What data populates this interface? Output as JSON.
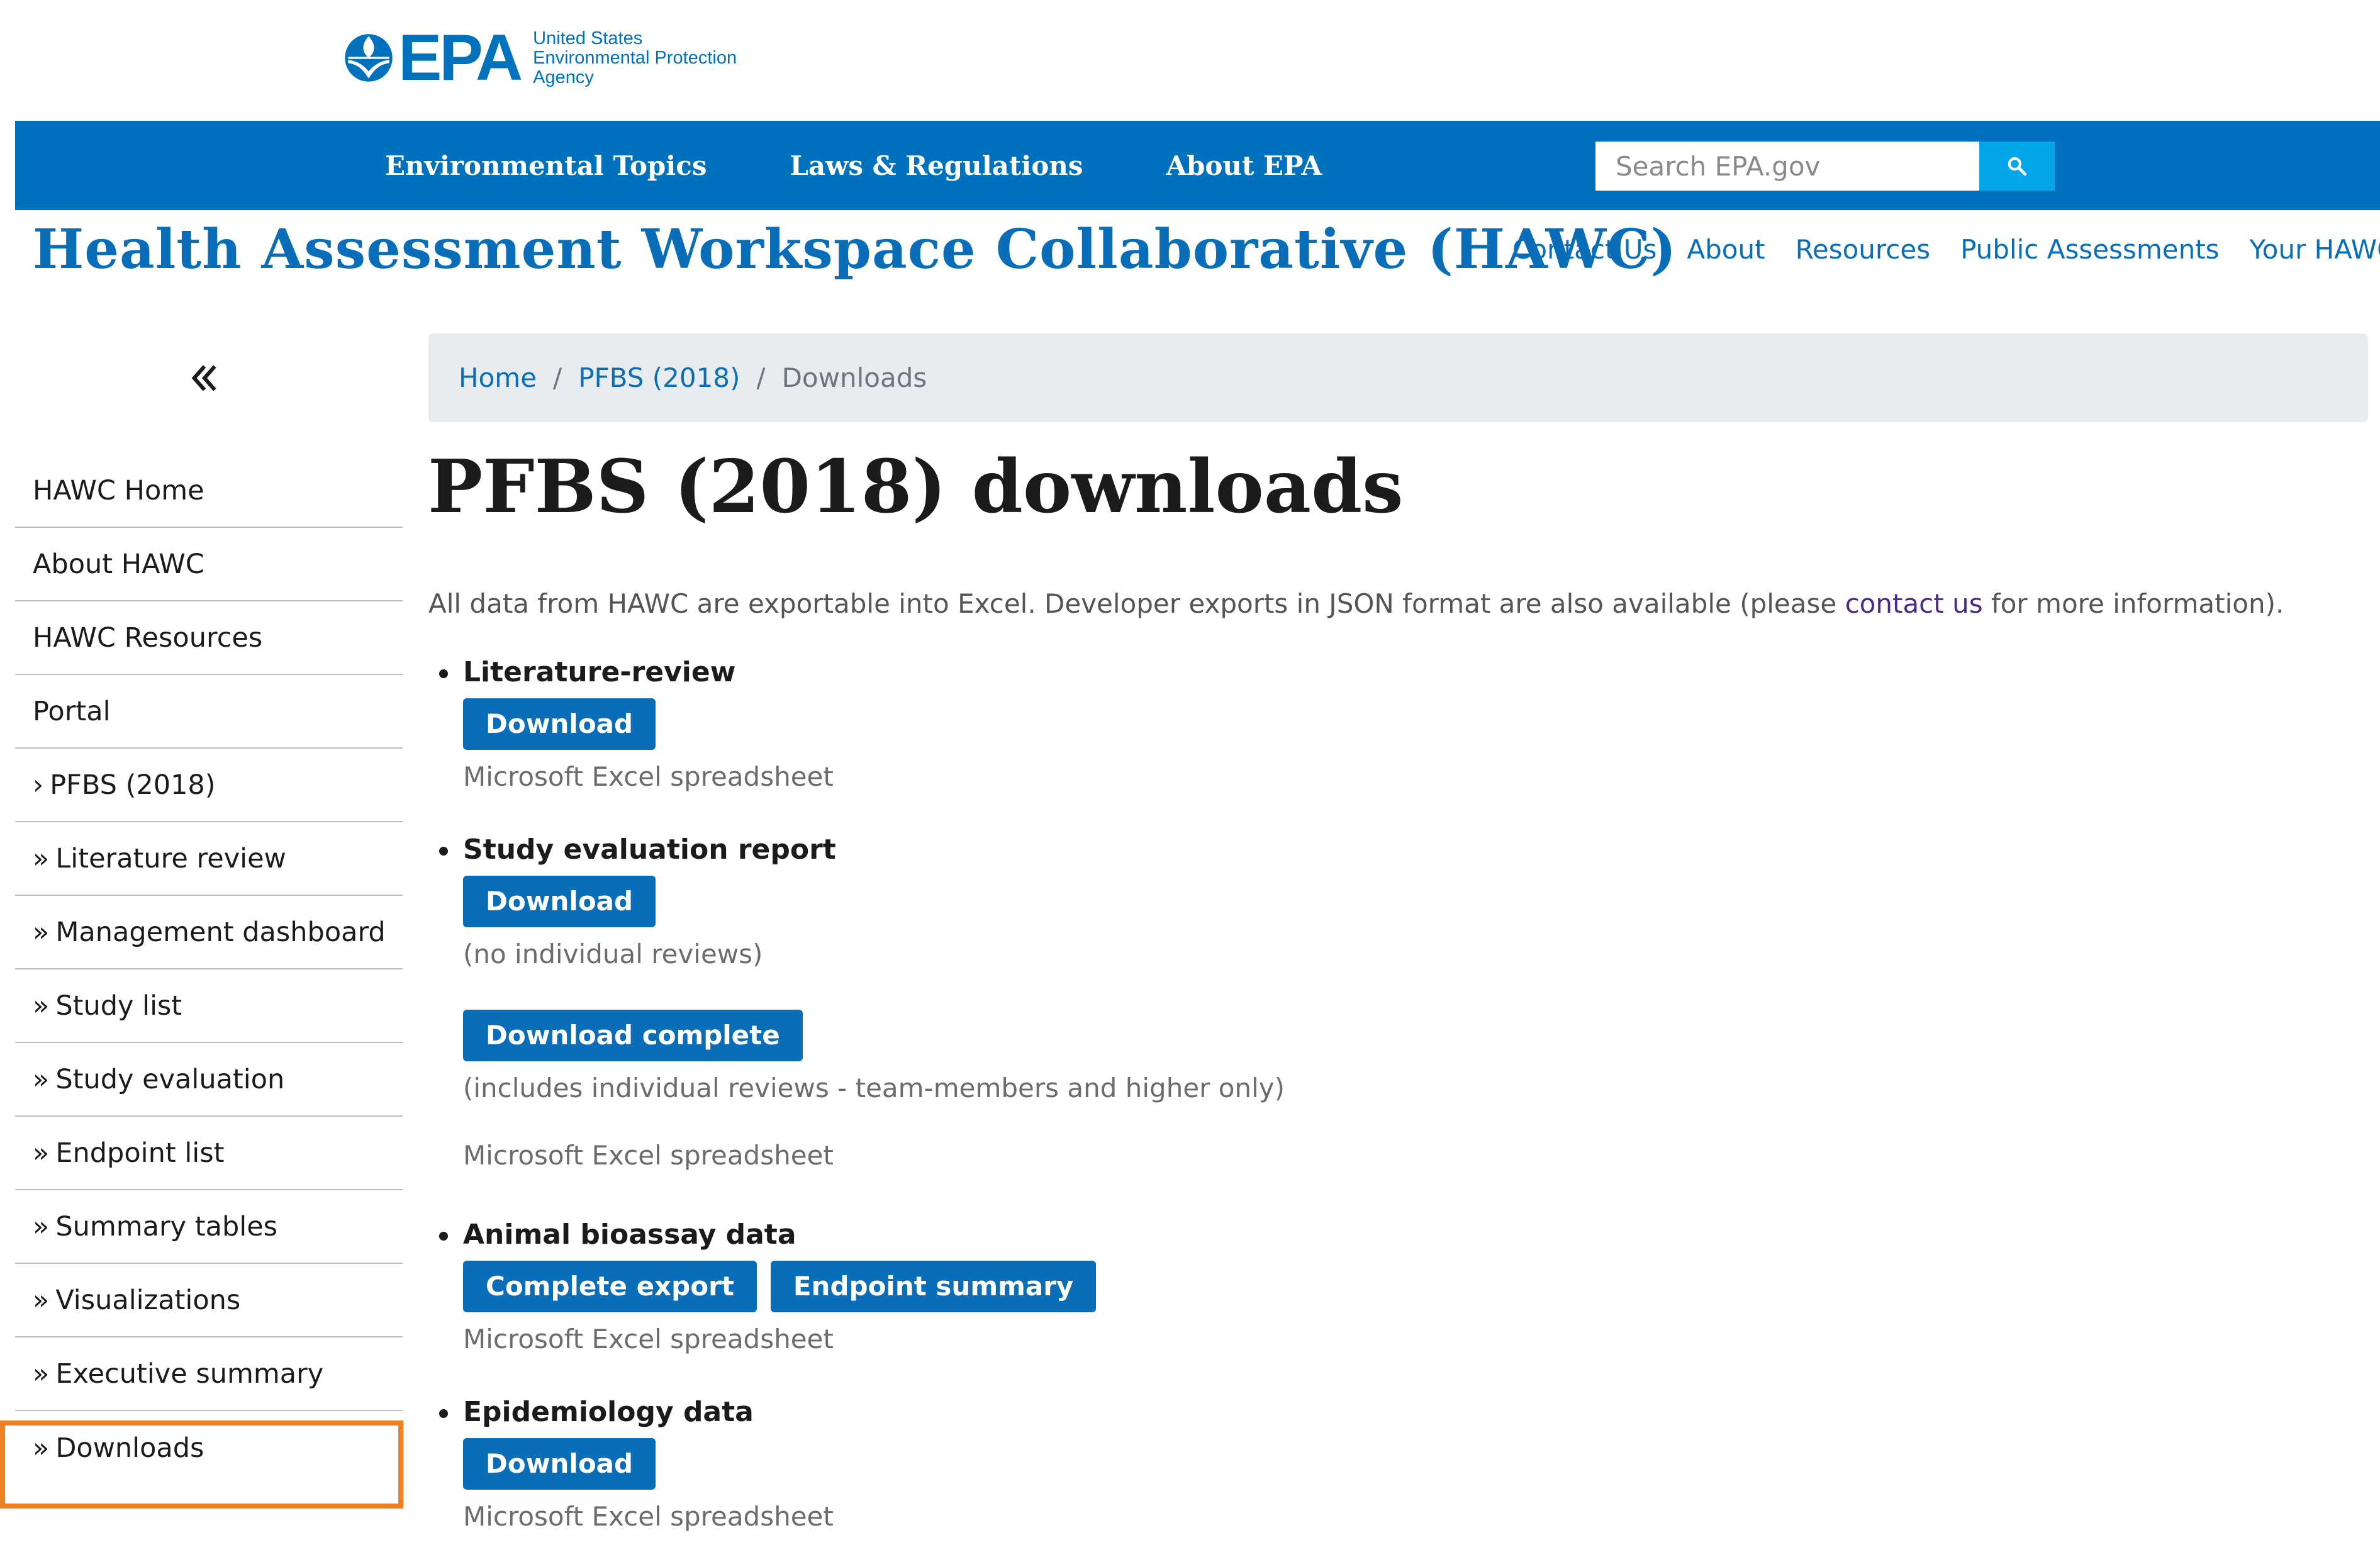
{
  "epa": {
    "logo_word": "EPA",
    "subtitle": [
      "United States",
      "Environmental Protection",
      "Agency"
    ]
  },
  "topnav": {
    "items": [
      "Environmental Topics",
      "Laws & Regulations",
      "About EPA"
    ],
    "search_placeholder": "Search EPA.gov",
    "search_icon": "search-icon"
  },
  "hawc": {
    "title": "Health Assessment Workspace Collaborative (HAWC)",
    "nav": [
      "Contact Us",
      "About",
      "Resources",
      "Public Assessments",
      "Your HAWC"
    ]
  },
  "sidebar": {
    "collapse_icon": "double-chevron-left-icon",
    "items": [
      {
        "prefix": "",
        "label": "HAWC Home"
      },
      {
        "prefix": "",
        "label": "About HAWC"
      },
      {
        "prefix": "",
        "label": "HAWC Resources"
      },
      {
        "prefix": "",
        "label": "Portal"
      },
      {
        "prefix": "›",
        "label": "PFBS (2018)"
      },
      {
        "prefix": "»",
        "label": "Literature review"
      },
      {
        "prefix": "»",
        "label": "Management dashboard"
      },
      {
        "prefix": "»",
        "label": "Study list"
      },
      {
        "prefix": "»",
        "label": "Study evaluation"
      },
      {
        "prefix": "»",
        "label": "Endpoint list"
      },
      {
        "prefix": "»",
        "label": "Summary tables"
      },
      {
        "prefix": "»",
        "label": "Visualizations"
      },
      {
        "prefix": "»",
        "label": "Executive summary"
      },
      {
        "prefix": "»",
        "label": "Downloads"
      }
    ],
    "highlight_color": "#f07f22"
  },
  "breadcrumb": {
    "home": "Home",
    "sep": "/",
    "parent": "PFBS (2018)",
    "current": "Downloads"
  },
  "main": {
    "title": "PFBS (2018) downloads",
    "intro_before": "All data from HAWC are exportable into Excel. Developer exports in JSON format are also available (please ",
    "intro_link": "contact us",
    "intro_after": " for more information).",
    "sections": {
      "lit": {
        "heading": "Literature-review",
        "button": "Download",
        "note": "Microsoft Excel spreadsheet"
      },
      "study_eval": {
        "heading": "Study evaluation report",
        "button": "Download",
        "note1": "(no individual reviews)",
        "button2": "Download complete",
        "note2": "(includes individual reviews - team-members and higher only)",
        "note3": "Microsoft Excel spreadsheet"
      },
      "animal": {
        "heading": "Animal bioassay data",
        "button1": "Complete export",
        "button2": "Endpoint summary",
        "note": "Microsoft Excel spreadsheet"
      },
      "epi": {
        "heading": "Epidemiology data",
        "button": "Download",
        "note": "Microsoft Excel spreadsheet"
      }
    }
  },
  "colors": {
    "epa_blue": "#0071bc",
    "hawc_blue": "#0a6db8",
    "search_button": "#00a6e8",
    "breadcrumb_bg": "#e9ecef",
    "link_purple": "#4a2a8c"
  }
}
